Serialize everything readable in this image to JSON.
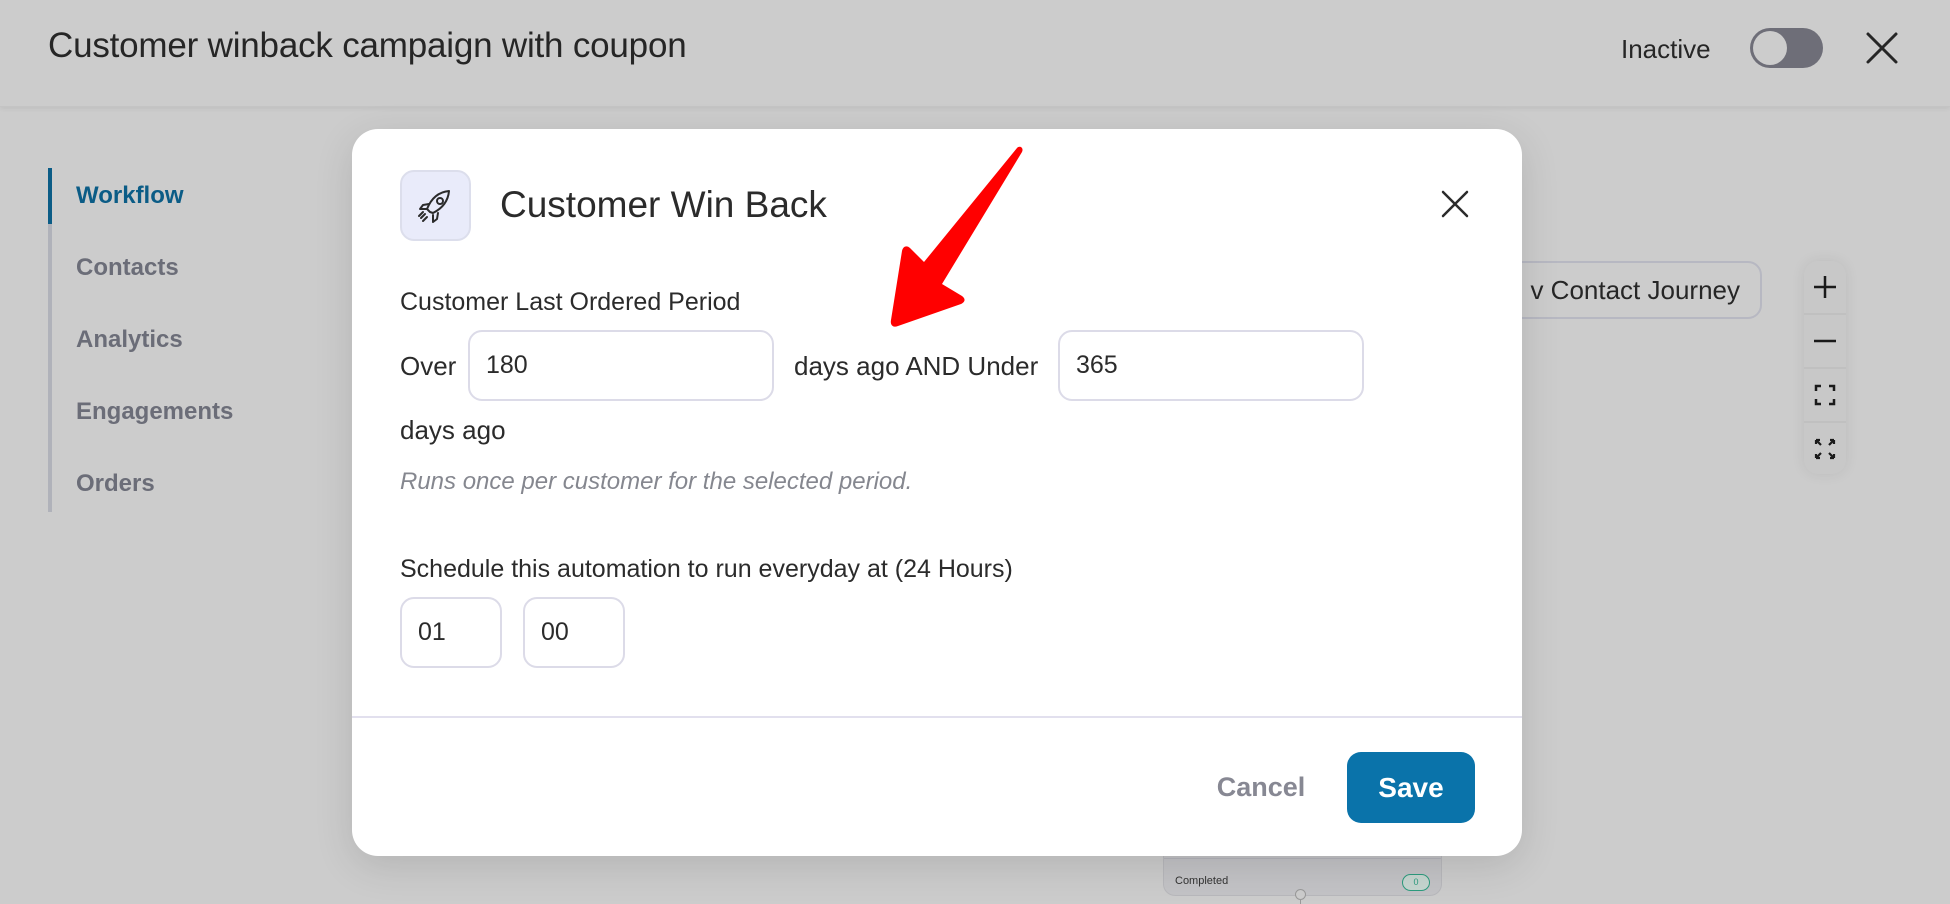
{
  "header": {
    "title": "Customer winback campaign with coupon",
    "status_label": "Inactive",
    "toggle_on": false
  },
  "sidebar": {
    "items": [
      {
        "label": "Workflow",
        "active": true
      },
      {
        "label": "Contacts",
        "active": false
      },
      {
        "label": "Analytics",
        "active": false
      },
      {
        "label": "Engagements",
        "active": false
      },
      {
        "label": "Orders",
        "active": false
      }
    ]
  },
  "canvas": {
    "journey_button_label": "View Contact Journey",
    "journey_button_visible_label": "v Contact Journey",
    "zoom_controls": [
      "zoom-in",
      "zoom-out",
      "fit-view",
      "fullscreen"
    ],
    "node": {
      "status_label": "Completed",
      "count": "0"
    }
  },
  "modal": {
    "icon": "rocket-icon",
    "title": "Customer Win Back",
    "period": {
      "label": "Customer Last Ordered Period",
      "prefix": "Over",
      "from_value": "180",
      "middle": "days ago AND Under",
      "to_value": "365",
      "suffix": "days ago",
      "hint": "Runs once per customer for the selected period."
    },
    "schedule": {
      "label": "Schedule this automation to run everyday at (24 Hours)",
      "hour": "01",
      "minute": "00"
    },
    "cancel_label": "Cancel",
    "save_label": "Save"
  },
  "colors": {
    "accent": "#0a73aa",
    "sidebar_active": "#0b5c86",
    "annotation": "#ff0000",
    "badge": "#2d9c7e"
  }
}
